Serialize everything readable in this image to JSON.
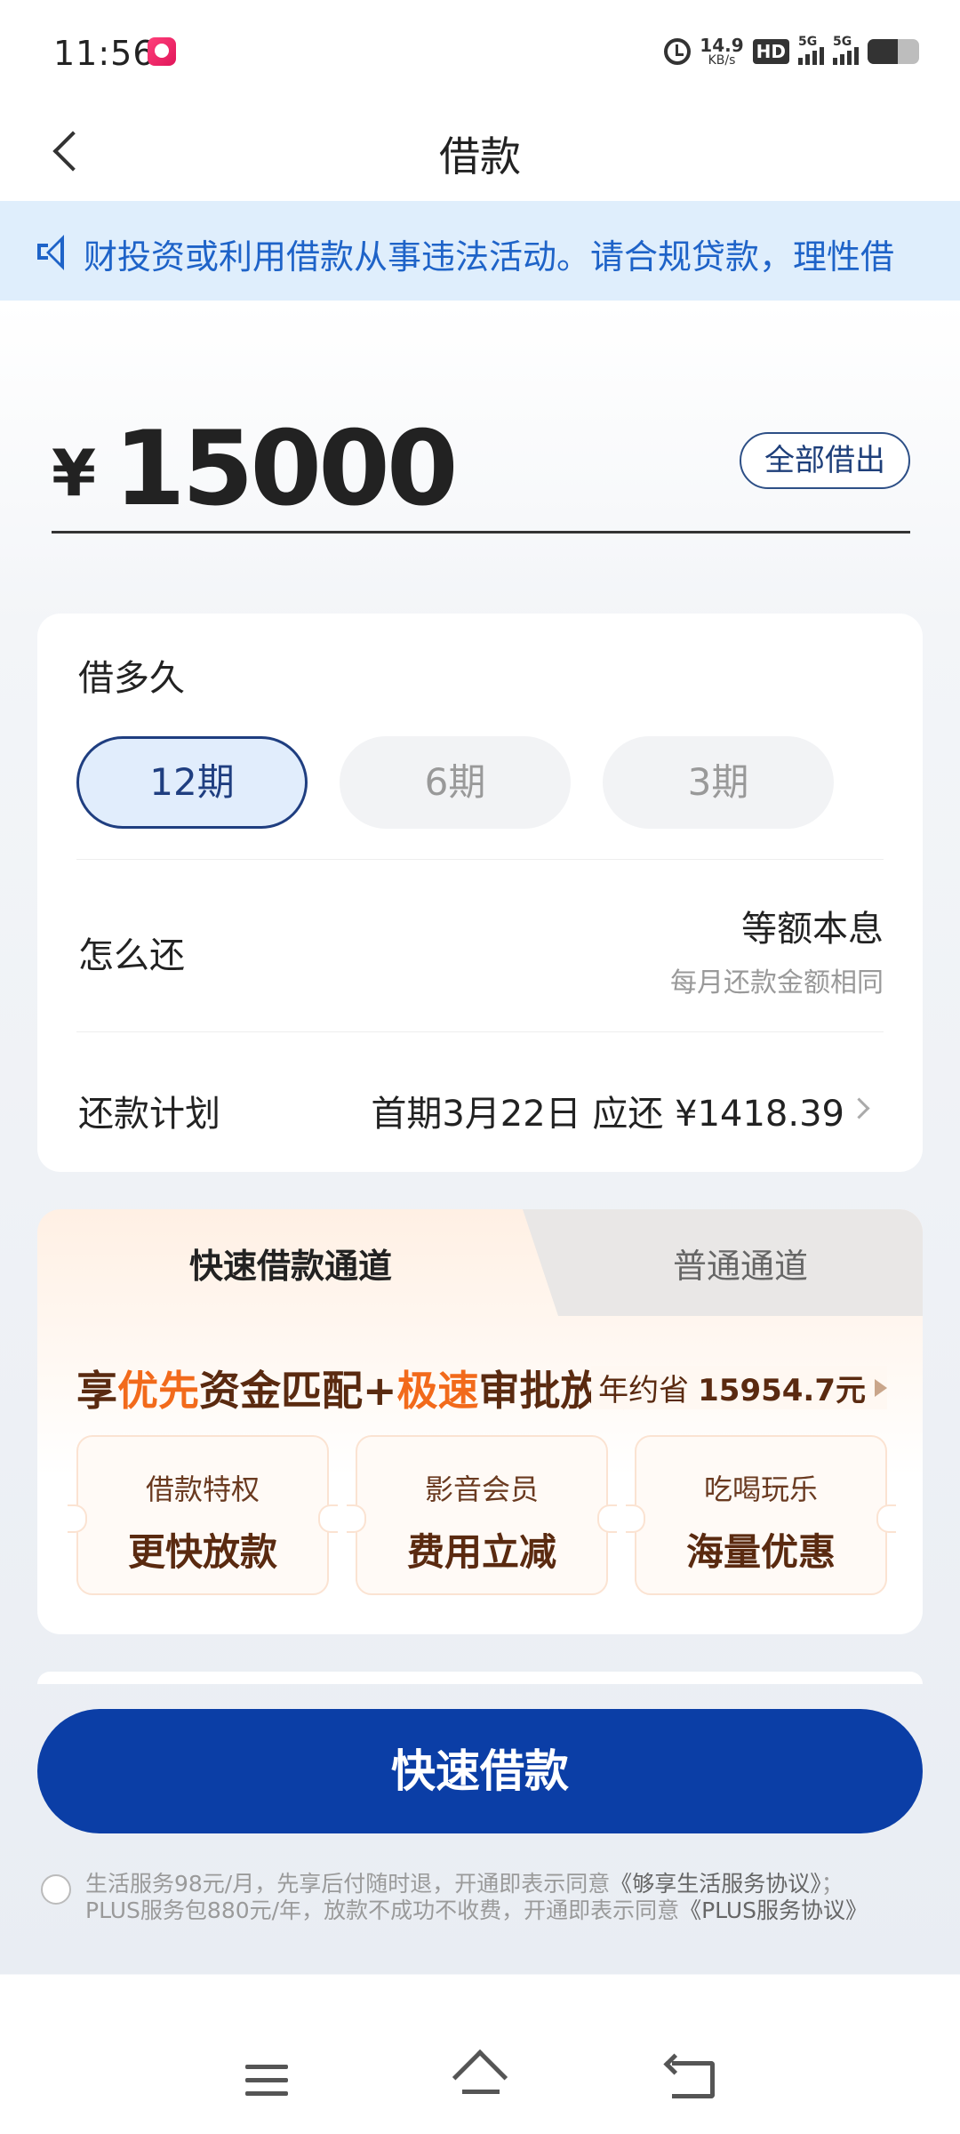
{
  "status_bar": {
    "time": "11:56",
    "net_speed": "14.9",
    "net_unit": "KB/s",
    "hd_label": "HD",
    "signal1_label": "5G",
    "signal2_label": "5G"
  },
  "nav": {
    "title": "借款"
  },
  "notice": {
    "text": "财投资或利用借款从事违法活动。请合规贷款，理性借"
  },
  "amount": {
    "currency": "¥",
    "value": "15000",
    "borrow_all_label": "全部借出"
  },
  "loan_term": {
    "title": "借多久",
    "options": [
      {
        "label": "12期",
        "selected": true
      },
      {
        "label": "6期",
        "selected": false
      },
      {
        "label": "3期",
        "selected": false
      }
    ]
  },
  "repay_method": {
    "label": "怎么还",
    "value": "等额本息",
    "desc": "每月还款金额相同"
  },
  "repay_plan": {
    "label": "还款计划",
    "value": "首期3月22日 应还 ¥1418.39"
  },
  "channels": {
    "tabs": [
      {
        "label": "快速借款通道",
        "active": true
      },
      {
        "label": "普通通道",
        "active": false
      }
    ],
    "promo_parts": [
      "享",
      "优先",
      "资金匹配+",
      "极速",
      "审批放款"
    ],
    "saving_prefix": "年约省",
    "saving_value": "15954.7元",
    "perks": [
      {
        "subtitle": "借款特权",
        "title": "更快放款"
      },
      {
        "subtitle": "影音会员",
        "title": "费用立减"
      },
      {
        "subtitle": "吃喝玩乐",
        "title": "海量优惠"
      }
    ]
  },
  "cta": {
    "label": "快速借款"
  },
  "agreement": {
    "line1_text": "生活服务98元/月，先享后付随时退，开通即表示同意",
    "line1_link": "《够享生活服务协议》",
    "line1_end": "；",
    "line2_text": "PLUS服务包880元/年，放款不成功不收费，开通即表示同意",
    "line2_link": "《PLUS服务协议》"
  },
  "colors": {
    "primary": "#0b3ea6",
    "accent_orange": "#f26a1b",
    "notice_blue": "#1e63c8"
  }
}
